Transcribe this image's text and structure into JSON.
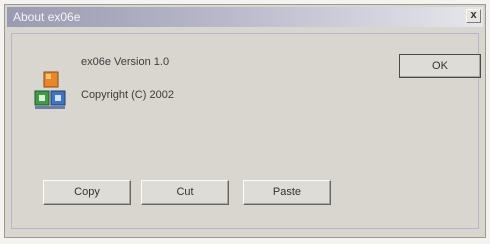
{
  "window": {
    "title": "About ex06e",
    "close_glyph": "x"
  },
  "about": {
    "version_text": "ex06e Version 1.0",
    "copyright_text": "Copyright (C) 2002"
  },
  "buttons": {
    "ok_label": "OK",
    "copy_label": "Copy",
    "cut_label": "Cut",
    "paste_label": "Paste"
  },
  "icons": {
    "app": "application-icon",
    "close": "close-icon"
  },
  "colors": {
    "dialog_face": "#d8d6cf",
    "title_gradient_start": "#9a9ab2",
    "title_gradient_end": "#e6e6ec",
    "icon_orange": "#e8862a",
    "icon_blue": "#3f74c0",
    "icon_green": "#3f9a4c"
  }
}
